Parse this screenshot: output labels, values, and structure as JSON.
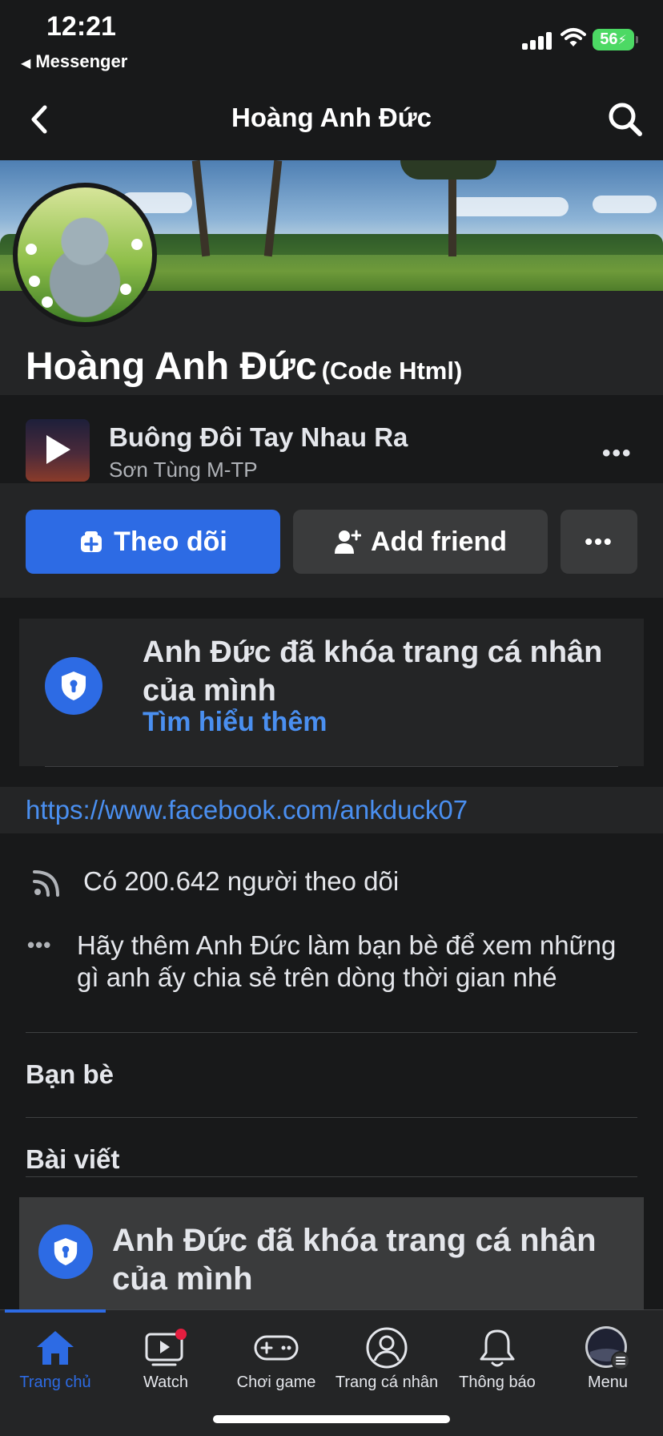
{
  "status_bar": {
    "time": "12:21",
    "back_app": "Messenger",
    "battery": "56"
  },
  "header": {
    "title": "Hoàng Anh Đức"
  },
  "profile": {
    "name": "Hoàng Anh Đức",
    "alt_name": "(Code Html)"
  },
  "music": {
    "title": "Buông Đôi Tay Nhau Ra",
    "artist": "Sơn Tùng M-TP",
    "more": "•••"
  },
  "actions": {
    "follow_label": "Theo dõi",
    "add_friend_label": "Add friend",
    "more_label": "•••"
  },
  "locked_notice": {
    "title": "Anh Đức đã khóa trang cá nhân của mình",
    "link": "Tìm hiểu thêm"
  },
  "profile_url": "https://www.facebook.com/ankduck07",
  "info": {
    "followers": "Có 200.642 người theo dõi",
    "add_friend_hint": "Hãy thêm Anh Đức làm bạn bè để xem những gì anh ấy chia sẻ trên dòng thời gian nhé",
    "hint_dots": "•••"
  },
  "sections": {
    "friends": "Bạn bè",
    "posts": "Bài viết"
  },
  "locked_notice_2": {
    "title": "Anh Đức đã khóa trang cá nhân của mình"
  },
  "tabbar": {
    "items": [
      {
        "label": "Trang chủ",
        "icon": "home-icon",
        "active": true
      },
      {
        "label": "Watch",
        "icon": "watch-icon",
        "badge": true
      },
      {
        "label": "Chơi game",
        "icon": "gamepad-icon"
      },
      {
        "label": "Trang cá nhân",
        "icon": "profile-icon"
      },
      {
        "label": "Thông báo",
        "icon": "bell-icon"
      },
      {
        "label": "Menu",
        "icon": "menu-avatar-icon"
      }
    ]
  },
  "colors": {
    "background": "#18191a",
    "surface": "#242526",
    "accent": "#2d6be4",
    "link": "#4a8ff0"
  }
}
